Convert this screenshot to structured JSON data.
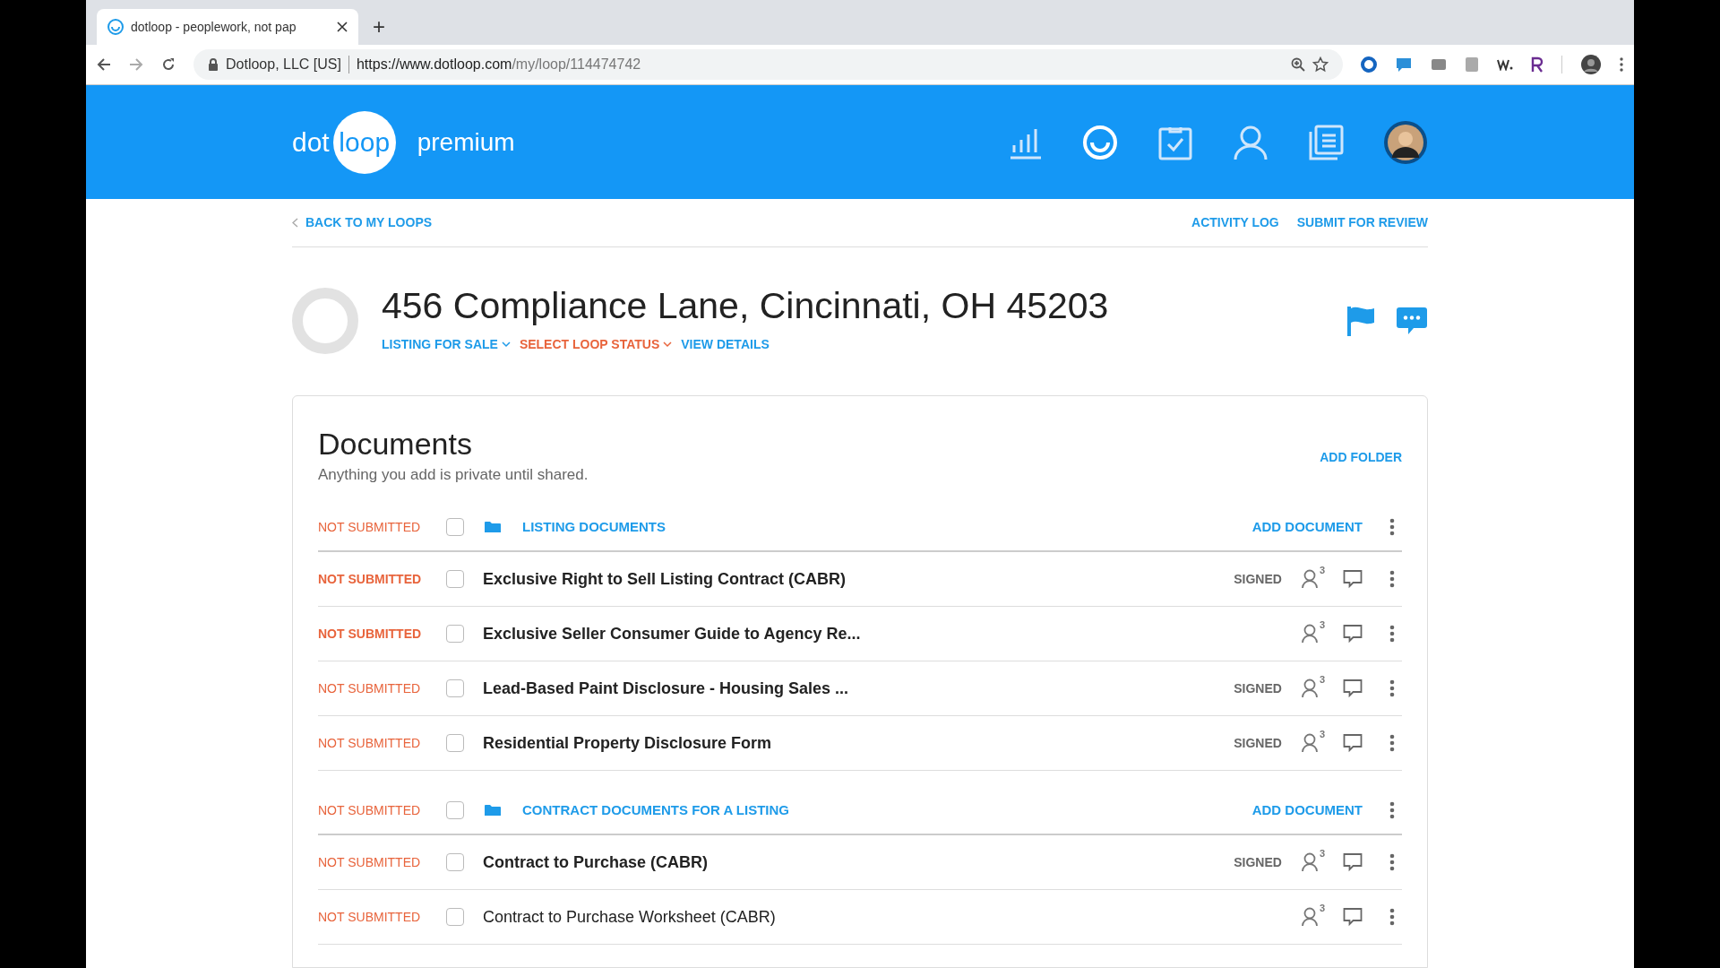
{
  "browser": {
    "tab_title": "dotloop - peoplework, not pap",
    "new_tab": "+",
    "site_identity": "Dotloop, LLC [US]",
    "url_host": "https://www.dotloop.com",
    "url_path": "/my/loop/114474742"
  },
  "app": {
    "logo_dot": "dot",
    "logo_loop": "loop",
    "plan": "premium"
  },
  "nav": {
    "back": "BACK TO MY LOOPS",
    "actions": [
      "ACTIVITY LOG",
      "SUBMIT FOR REVIEW"
    ]
  },
  "loop": {
    "title": "456 Compliance Lane, Cincinnati, OH 45203",
    "links": [
      {
        "label": "LISTING FOR SALE",
        "kind": "dropdown",
        "color": "#1e9be9"
      },
      {
        "label": "SELECT LOOP STATUS",
        "kind": "dropdown",
        "color": "#e8643c"
      },
      {
        "label": "VIEW DETAILS",
        "kind": "link",
        "color": "#1e9be9"
      }
    ]
  },
  "documents": {
    "title": "Documents",
    "subtitle": "Anything you add is private until shared.",
    "add_folder": "ADD FOLDER",
    "folders": [
      {
        "status": "NOT SUBMITTED",
        "checked": false,
        "name": "LISTING DOCUMENTS",
        "add": "ADD DOCUMENT",
        "rows": [
          {
            "status": "NOT SUBMITTED",
            "status_emphasis": true,
            "checked": false,
            "name": "Exclusive Right to Sell Listing Contract (CABR)",
            "unread": true,
            "signed": "SIGNED",
            "participants": "3"
          },
          {
            "status": "NOT SUBMITTED",
            "status_emphasis": true,
            "checked": false,
            "name": "Exclusive Seller Consumer Guide to Agency Re...",
            "unread": true,
            "participants": "3"
          },
          {
            "status": "NOT SUBMITTED",
            "status_emphasis": false,
            "checked": false,
            "name": "Lead-Based Paint Disclosure - Housing Sales ...",
            "unread": true,
            "signed": "SIGNED",
            "participants": "3"
          },
          {
            "status": "NOT SUBMITTED",
            "status_emphasis": false,
            "checked": false,
            "name": "Residential Property Disclosure Form",
            "unread": true,
            "signed": "SIGNED",
            "participants": "3"
          }
        ]
      },
      {
        "status": "NOT SUBMITTED",
        "checked": false,
        "name": "CONTRACT DOCUMENTS FOR A LISTING",
        "add": "ADD DOCUMENT",
        "rows": [
          {
            "status": "NOT SUBMITTED",
            "status_emphasis": false,
            "checked": false,
            "name": "Contract to Purchase (CABR)",
            "unread": true,
            "signed": "SIGNED",
            "participants": "3"
          },
          {
            "status": "NOT SUBMITTED",
            "status_emphasis": false,
            "checked": false,
            "name": "Contract to Purchase Worksheet (CABR)",
            "unread": false,
            "participants": "3"
          }
        ]
      }
    ]
  }
}
